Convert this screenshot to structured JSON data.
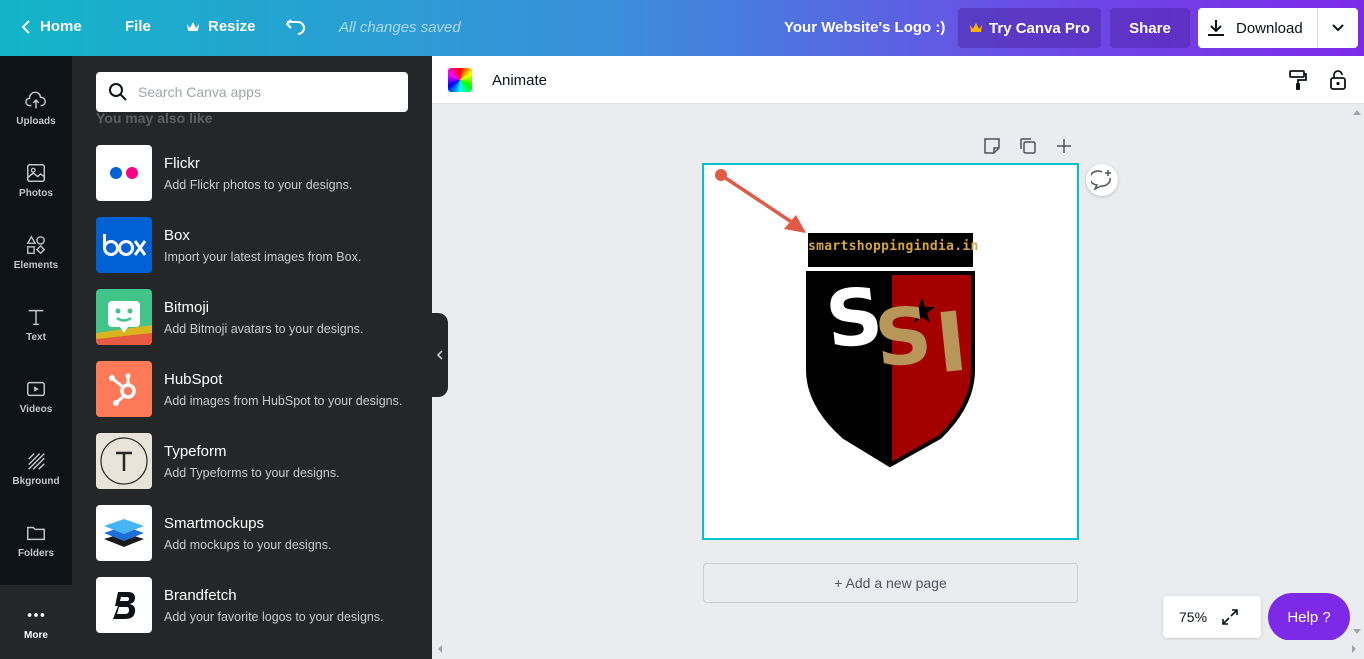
{
  "topbar": {
    "home": "Home",
    "file": "File",
    "resize": "Resize",
    "saved_status": "All changes saved",
    "design_title": "Your Website's Logo :)",
    "try_pro": "Try Canva Pro",
    "share": "Share",
    "download": "Download"
  },
  "rail": [
    {
      "label": "Uploads",
      "icon": "upload-icon"
    },
    {
      "label": "Photos",
      "icon": "photo-icon"
    },
    {
      "label": "Elements",
      "icon": "shapes-icon"
    },
    {
      "label": "Text",
      "icon": "text-icon"
    },
    {
      "label": "Videos",
      "icon": "video-icon"
    },
    {
      "label": "Bkground",
      "icon": "background-icon"
    },
    {
      "label": "Folders",
      "icon": "folder-icon"
    },
    {
      "label": "More",
      "icon": "more-icon"
    }
  ],
  "panel": {
    "search_placeholder": "Search Canva apps",
    "section_label": "You may also like",
    "apps": [
      {
        "name": "Flickr",
        "desc": "Add Flickr photos to your designs."
      },
      {
        "name": "Box",
        "desc": "Import your latest images from Box."
      },
      {
        "name": "Bitmoji",
        "desc": "Add Bitmoji avatars to your designs."
      },
      {
        "name": "HubSpot",
        "desc": "Add images from HubSpot to your designs."
      },
      {
        "name": "Typeform",
        "desc": "Add Typeforms to your designs."
      },
      {
        "name": "Smartmockups",
        "desc": "Add mockups to your designs."
      },
      {
        "name": "Brandfetch",
        "desc": "Add your favorite logos to your designs."
      }
    ]
  },
  "editor": {
    "animate": "Animate",
    "add_page": "+ Add a new page",
    "zoom": "75%",
    "help": "Help ?"
  },
  "logo": {
    "banner_text": "smartshoppingindia.in",
    "letters": "SSI",
    "colors": {
      "black": "#000000",
      "red": "#a50000",
      "gold": "#b8965a",
      "arrow": "#e05a47"
    }
  },
  "colors": {
    "accent": "#7d2ae8",
    "selection": "#00c4cc",
    "panel_bg": "#252627",
    "rail_bg": "#0e1318"
  }
}
